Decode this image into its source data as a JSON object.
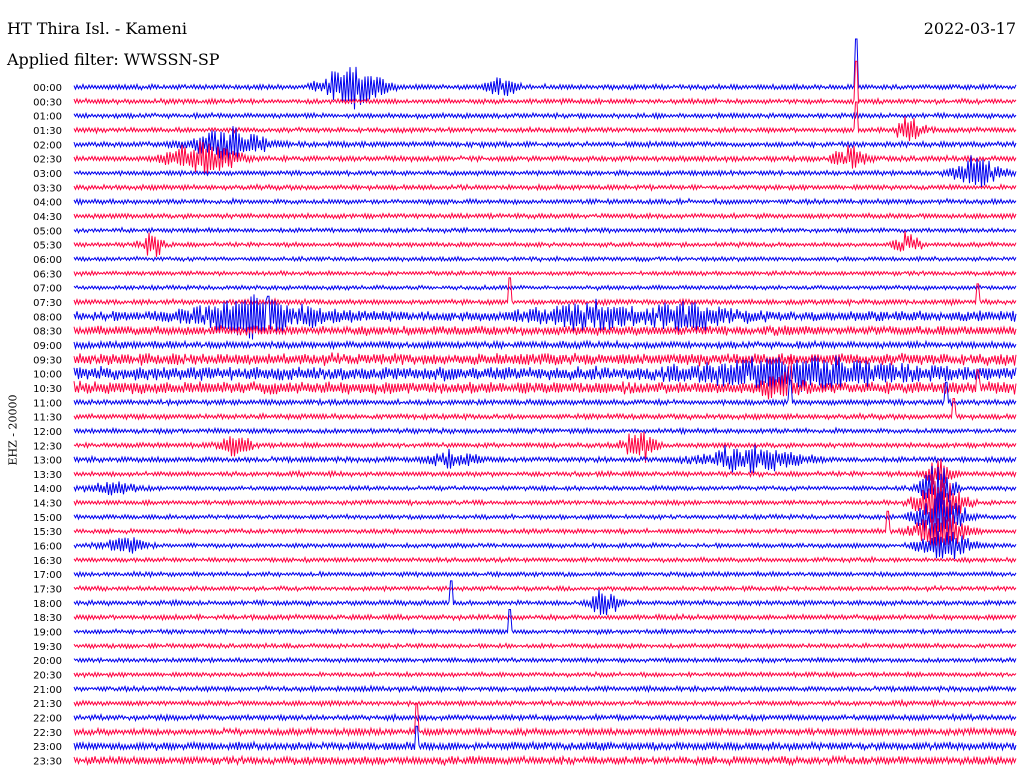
{
  "header": {
    "station": "HT Thira Isl. - Kameni",
    "date": "2022-03-17",
    "filter_label": "Applied filter: WWSSN-SP",
    "channel": "EHZ - 20000"
  },
  "chart_data": {
    "type": "line",
    "title": "HT Thira Isl. - Kameni",
    "date": "2022-03-17",
    "filter": "WWSSN-SP",
    "channel": "EHZ - 20000",
    "ylabel": "EHZ - 20000",
    "trace_colors": [
      "#0000ee",
      "#ff0040"
    ],
    "row_labels": [
      "00:00",
      "00:30",
      "01:00",
      "01:30",
      "02:00",
      "02:30",
      "03:00",
      "03:30",
      "04:00",
      "04:30",
      "05:00",
      "05:30",
      "06:00",
      "06:30",
      "07:00",
      "07:30",
      "08:00",
      "08:30",
      "09:00",
      "09:30",
      "10:00",
      "10:30",
      "11:00",
      "11:30",
      "12:00",
      "12:30",
      "13:00",
      "13:30",
      "14:00",
      "14:30",
      "15:00",
      "15:30",
      "16:00",
      "16:30",
      "17:00",
      "17:30",
      "18:00",
      "18:30",
      "19:00",
      "19:30",
      "20:00",
      "20:30",
      "21:00",
      "21:30",
      "22:00",
      "22:30",
      "23:00",
      "23:30"
    ],
    "noise_level": [
      2.2,
      2.2,
      2.2,
      2.2,
      2.4,
      2.4,
      2.2,
      2.2,
      2.2,
      2.2,
      2.0,
      2.0,
      1.9,
      1.9,
      1.9,
      2.3,
      4.5,
      4.0,
      3.0,
      5.2,
      6.0,
      5.5,
      2.5,
      2.3,
      2.2,
      2.2,
      2.4,
      2.2,
      2.0,
      2.0,
      2.0,
      2.0,
      2.0,
      2.0,
      2.0,
      2.0,
      2.2,
      2.2,
      2.0,
      2.0,
      2.0,
      2.0,
      2.2,
      2.2,
      2.5,
      3.0,
      3.5,
      3.5
    ],
    "events": [
      {
        "row": 0,
        "minute": 8.9,
        "amplitude": 18,
        "duration": 1.2
      },
      {
        "row": 0,
        "minute": 13.6,
        "amplitude": 8,
        "duration": 0.6
      },
      {
        "row": 4,
        "minute": 4.9,
        "amplitude": 14,
        "duration": 1.5
      },
      {
        "row": 5,
        "minute": 4.1,
        "amplitude": 16,
        "duration": 1.4
      },
      {
        "row": 6,
        "minute": 28.8,
        "amplitude": 14,
        "duration": 0.9
      },
      {
        "row": 5,
        "minute": 24.7,
        "amplitude": 10,
        "duration": 0.6
      },
      {
        "row": 3,
        "minute": 26.6,
        "amplitude": 10,
        "duration": 0.6
      },
      {
        "row": 11,
        "minute": 2.5,
        "amplitude": 9,
        "duration": 0.5
      },
      {
        "row": 11,
        "minute": 26.5,
        "amplitude": 9,
        "duration": 0.5
      },
      {
        "row": 16,
        "minute": 5.8,
        "amplitude": 16,
        "duration": 2.5
      },
      {
        "row": 16,
        "minute": 16.2,
        "amplitude": 10,
        "duration": 2.0
      },
      {
        "row": 16,
        "minute": 19.5,
        "amplitude": 10,
        "duration": 2.0
      },
      {
        "row": 20,
        "minute": 23.0,
        "amplitude": 12,
        "duration": 4.0
      },
      {
        "row": 21,
        "minute": 22.5,
        "amplitude": 10,
        "duration": 0.8
      },
      {
        "row": 25,
        "minute": 18.0,
        "amplitude": 14,
        "duration": 0.6
      },
      {
        "row": 25,
        "minute": 5.2,
        "amplitude": 8,
        "duration": 0.6
      },
      {
        "row": 26,
        "minute": 21.5,
        "amplitude": 11,
        "duration": 2.0
      },
      {
        "row": 26,
        "minute": 12.0,
        "amplitude": 6,
        "duration": 1.0
      },
      {
        "row": 28,
        "minute": 1.2,
        "amplitude": 5,
        "duration": 1.0
      },
      {
        "row": 32,
        "minute": 1.6,
        "amplitude": 7,
        "duration": 0.8
      },
      {
        "row": 36,
        "minute": 16.9,
        "amplitude": 11,
        "duration": 0.5
      },
      {
        "row": 27,
        "minute": 27.5,
        "amplitude": 14,
        "duration": 0.5
      },
      {
        "row": 28,
        "minute": 27.5,
        "amplitude": 22,
        "duration": 0.6
      },
      {
        "row": 29,
        "minute": 27.6,
        "amplitude": 26,
        "duration": 0.9
      },
      {
        "row": 30,
        "minute": 27.6,
        "amplitude": 24,
        "duration": 0.9
      },
      {
        "row": 31,
        "minute": 27.6,
        "amplitude": 18,
        "duration": 1.0
      },
      {
        "row": 32,
        "minute": 27.7,
        "amplitude": 12,
        "duration": 1.0
      }
    ],
    "spikes": [
      {
        "row": 0,
        "minute": 24.9,
        "amplitude": 48
      },
      {
        "row": 1,
        "minute": 24.9,
        "amplitude": 40
      },
      {
        "row": 3,
        "minute": 24.9,
        "amplitude": 28
      },
      {
        "row": 21,
        "minute": 22.8,
        "amplitude": 30
      },
      {
        "row": 22,
        "minute": 22.8,
        "amplitude": 22
      },
      {
        "row": 15,
        "minute": 13.9,
        "amplitude": 24
      },
      {
        "row": 16,
        "minute": 6.2,
        "amplitude": 20
      },
      {
        "row": 36,
        "minute": 12.0,
        "amplitude": 22
      },
      {
        "row": 38,
        "minute": 13.9,
        "amplitude": 22
      },
      {
        "row": 45,
        "minute": 10.9,
        "amplitude": 28
      },
      {
        "row": 46,
        "minute": 10.9,
        "amplitude": 20
      },
      {
        "row": 15,
        "minute": 28.8,
        "amplitude": 18
      },
      {
        "row": 21,
        "minute": 28.8,
        "amplitude": 18
      },
      {
        "row": 31,
        "minute": 25.9,
        "amplitude": 20
      },
      {
        "row": 22,
        "minute": 27.8,
        "amplitude": 20
      },
      {
        "row": 23,
        "minute": 28.0,
        "amplitude": 18
      }
    ]
  }
}
